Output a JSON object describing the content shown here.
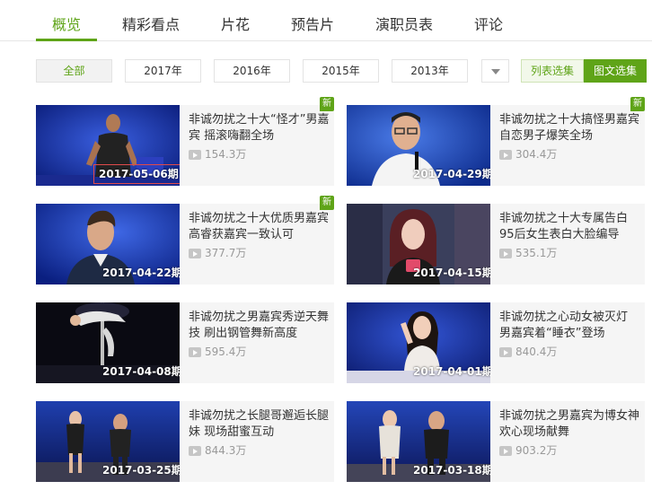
{
  "tabs": [
    {
      "label": "概览",
      "active": true
    },
    {
      "label": "精彩看点",
      "active": false
    },
    {
      "label": "片花",
      "active": false
    },
    {
      "label": "预告片",
      "active": false
    },
    {
      "label": "演职员表",
      "active": false
    },
    {
      "label": "评论",
      "active": false
    }
  ],
  "filters": [
    {
      "label": "全部",
      "active": true
    },
    {
      "label": "2017年",
      "active": false
    },
    {
      "label": "2016年",
      "active": false
    },
    {
      "label": "2015年",
      "active": false
    },
    {
      "label": "2013年",
      "active": false
    }
  ],
  "filter_more_icon": "chevron-down-icon",
  "view_modes": {
    "list": "列表选集",
    "grid": "图文选集",
    "active": "grid"
  },
  "colors": {
    "accent": "#5fa418",
    "date_outline": "#e04a4a"
  },
  "episodes": [
    {
      "date": "2017-05-06期",
      "title": "非诚勿扰之十大“怪才”男嘉宾 摇滚嗨翻全场",
      "plays": "154.3万",
      "is_new": true,
      "highlighted": true
    },
    {
      "date": "2017-04-29期",
      "title": "非诚勿扰之十大搞怪男嘉宾 自恋男子爆笑全场",
      "plays": "304.4万",
      "is_new": true,
      "highlighted": false
    },
    {
      "date": "2017-04-22期",
      "title": "非诚勿扰之十大优质男嘉宾 高睿获嘉宾一致认可",
      "plays": "377.7万",
      "is_new": true,
      "highlighted": false
    },
    {
      "date": "2017-04-15期",
      "title": "非诚勿扰之十大专属告白 95后女生表白大脸编导",
      "plays": "535.1万",
      "is_new": false,
      "highlighted": false
    },
    {
      "date": "2017-04-08期",
      "title": "非诚勿扰之男嘉宾秀逆天舞技 刷出钢管舞新高度",
      "plays": "595.4万",
      "is_new": false,
      "highlighted": false
    },
    {
      "date": "2017-04-01期",
      "title": "非诚勿扰之心动女被灭灯 男嘉宾着“睡衣”登场",
      "plays": "840.4万",
      "is_new": false,
      "highlighted": false
    },
    {
      "date": "2017-03-25期",
      "title": "非诚勿扰之长腿哥邂逅长腿妹 现场甜蜜互动",
      "plays": "844.3万",
      "is_new": false,
      "highlighted": false
    },
    {
      "date": "2017-03-18期",
      "title": "非诚勿扰之男嘉宾为博女神欢心现场献舞",
      "plays": "903.2万",
      "is_new": false,
      "highlighted": false
    }
  ],
  "new_badge_label": "新"
}
